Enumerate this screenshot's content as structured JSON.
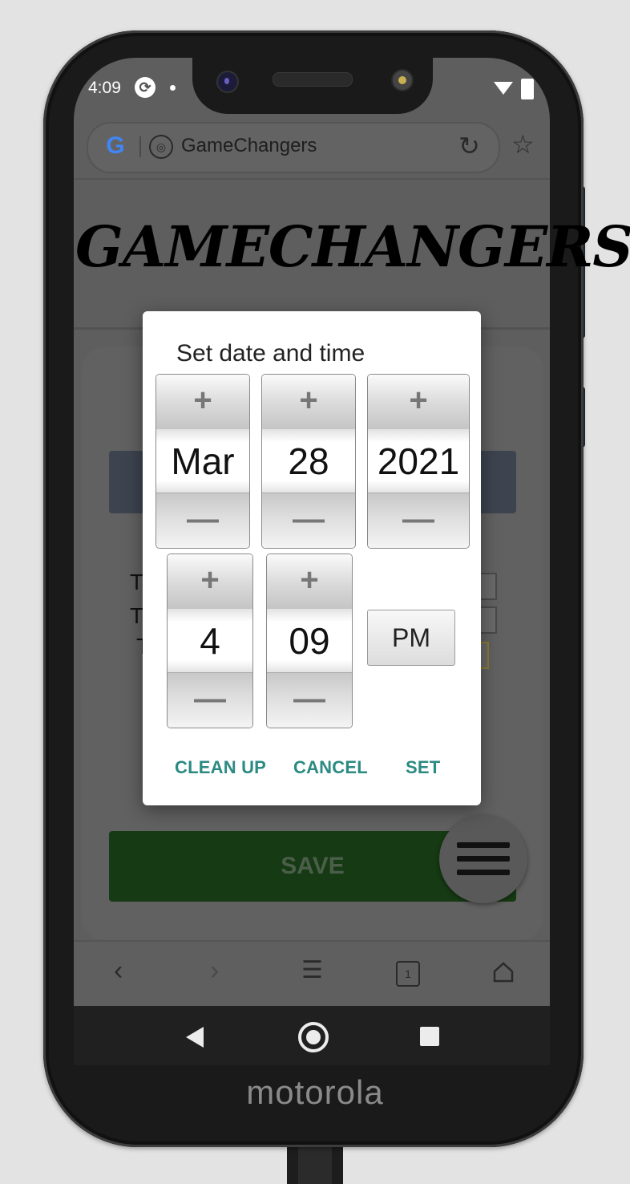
{
  "status_bar": {
    "time": "4:09"
  },
  "browser": {
    "url_text": "GameChangers",
    "google_logo": "G",
    "tabs_count": "1"
  },
  "page": {
    "site_title": "GAMECHANGERS",
    "bg_labels": [
      "T",
      "T",
      "T"
    ],
    "save_label": "SAVE"
  },
  "dialog": {
    "title": "Set date and time",
    "month": "Mar",
    "day": "28",
    "year": "2021",
    "hour": "4",
    "minute": "09",
    "ampm": "PM",
    "plus_symbol": "+",
    "minus_symbol": "—",
    "buttons": {
      "clean_up": "CLEAN UP",
      "cancel": "CANCEL",
      "set": "SET"
    }
  },
  "device": {
    "brand": "motorola"
  },
  "colors": {
    "accent": "#2b8a82",
    "save_bg": "#163a14",
    "blue_bar": "#3d4450"
  }
}
